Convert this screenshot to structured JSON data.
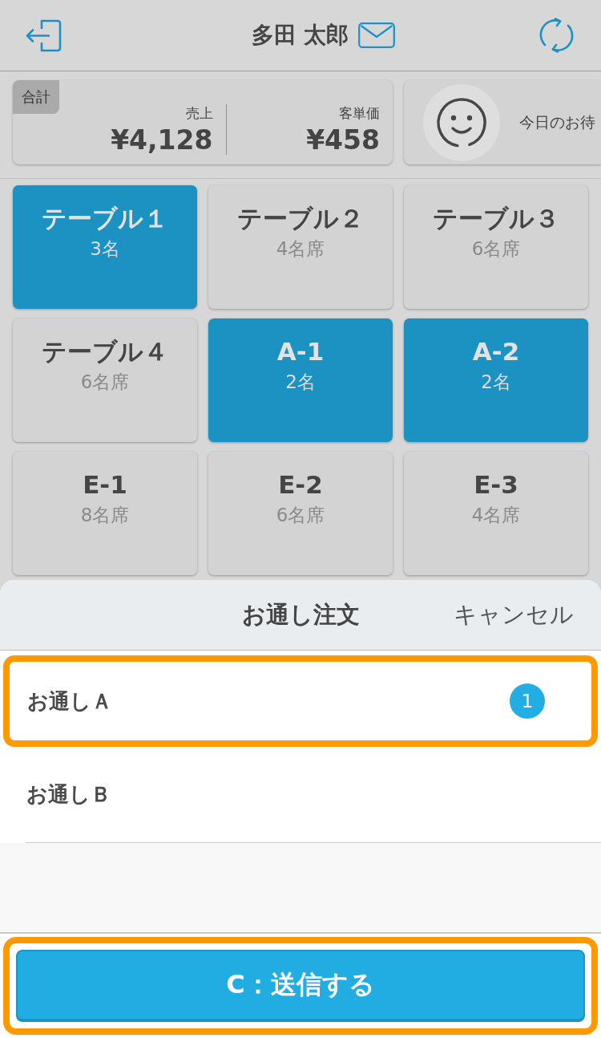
{
  "header": {
    "title": "多田 太郎"
  },
  "summary": {
    "tag": "合計",
    "metrics": [
      {
        "label": "売上",
        "value": "¥4,128"
      },
      {
        "label": "客単価",
        "value": "¥458"
      }
    ],
    "waiting": {
      "label": "今日のお待"
    }
  },
  "tables": [
    {
      "name": "テーブル１",
      "seats": "3名",
      "selected": true
    },
    {
      "name": "テーブル２",
      "seats": "4名席",
      "selected": false
    },
    {
      "name": "テーブル３",
      "seats": "6名席",
      "selected": false
    },
    {
      "name": "テーブル４",
      "seats": "6名席",
      "selected": false
    },
    {
      "name": "A-1",
      "seats": "2名",
      "selected": true
    },
    {
      "name": "A-2",
      "seats": "2名",
      "selected": true
    },
    {
      "name": "E-1",
      "seats": "8名席",
      "selected": false
    },
    {
      "name": "E-2",
      "seats": "6名席",
      "selected": false
    },
    {
      "name": "E-3",
      "seats": "4名席",
      "selected": false
    }
  ],
  "sheet": {
    "title": "お通し注文",
    "cancel": "キャンセル",
    "items": [
      {
        "label": "お通しＡ",
        "count": "1",
        "highlighted": true
      },
      {
        "label": "お通しＢ",
        "highlighted": false
      }
    ]
  },
  "send_button": {
    "label": "C：送信する",
    "highlighted": true
  }
}
